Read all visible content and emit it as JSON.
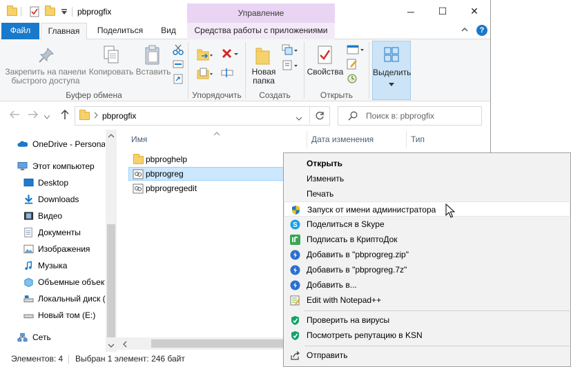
{
  "window": {
    "title": "pbprogfix",
    "minimize_glyph": "─",
    "maximize_glyph": "☐",
    "close_glyph": "✕"
  },
  "context_tab_header": "Управление",
  "tabs": {
    "file": "Файл",
    "home": "Главная",
    "share": "Поделиться",
    "view": "Вид",
    "apptools": "Средства работы с приложениями"
  },
  "ribbon": {
    "pin_line1": "Закрепить на панели",
    "pin_line2": "быстрого доступа",
    "copy": "Копировать",
    "paste": "Вставить",
    "group_clipboard": "Буфер обмена",
    "group_organize": "Упорядочить",
    "new_folder_line1": "Новая",
    "new_folder_line2": "папка",
    "group_new": "Создать",
    "properties": "Свойства",
    "group_open": "Открыть",
    "select": "Выделить"
  },
  "address": {
    "path": "pbprogfix",
    "search_placeholder": "Поиск в: pbprogfix"
  },
  "nav": {
    "items": [
      {
        "label": "OneDrive - Personal"
      },
      {
        "label": "Этот компьютер"
      },
      {
        "label": "Desktop"
      },
      {
        "label": "Downloads"
      },
      {
        "label": "Видео"
      },
      {
        "label": "Документы"
      },
      {
        "label": "Изображения"
      },
      {
        "label": "Музыка"
      },
      {
        "label": "Объемные объекты"
      },
      {
        "label": "Локальный диск (C:)"
      },
      {
        "label": "Новый том (E:)"
      },
      {
        "label": "Сеть"
      }
    ]
  },
  "columns": {
    "name": "Имя",
    "date": "Дата изменения",
    "type": "Тип"
  },
  "files": [
    {
      "name": "pbproghelp",
      "kind": "folder"
    },
    {
      "name": "pbprogreg",
      "kind": "link",
      "selected": true
    },
    {
      "name": "pbprogregedit",
      "kind": "link"
    }
  ],
  "status": {
    "count": "Элементов: 4",
    "selected": "Выбран 1 элемент: 246 байт"
  },
  "context_menu": {
    "items": [
      {
        "label": "Открыть",
        "bold": true
      },
      {
        "label": "Изменить"
      },
      {
        "label": "Печать"
      },
      {
        "label": "Запуск от имени администратора",
        "icon": "uac-shield-icon"
      },
      {
        "label": "Поделиться в Skype",
        "icon": "skype-icon"
      },
      {
        "label": "Подписать в КриптоДок",
        "icon": "cryptodoc-icon"
      },
      {
        "label": "Добавить в \"pbprogreg.zip\"",
        "icon": "archiver-icon"
      },
      {
        "label": "Добавить в \"pbprogreg.7z\"",
        "icon": "archiver-icon"
      },
      {
        "label": "Добавить в...",
        "icon": "archiver-icon"
      },
      {
        "label": "Edit with Notepad++",
        "icon": "notepadpp-icon"
      },
      {
        "label": "Проверить на вирусы",
        "icon": "kaspersky-icon"
      },
      {
        "label": "Посмотреть репутацию в KSN",
        "icon": "kaspersky-icon"
      },
      {
        "label": "Отправить",
        "icon": "share-icon"
      }
    ]
  },
  "colors": {
    "accent": "#1979ca",
    "context_tab": "#e9d5f3",
    "selection": "#cce8ff"
  }
}
